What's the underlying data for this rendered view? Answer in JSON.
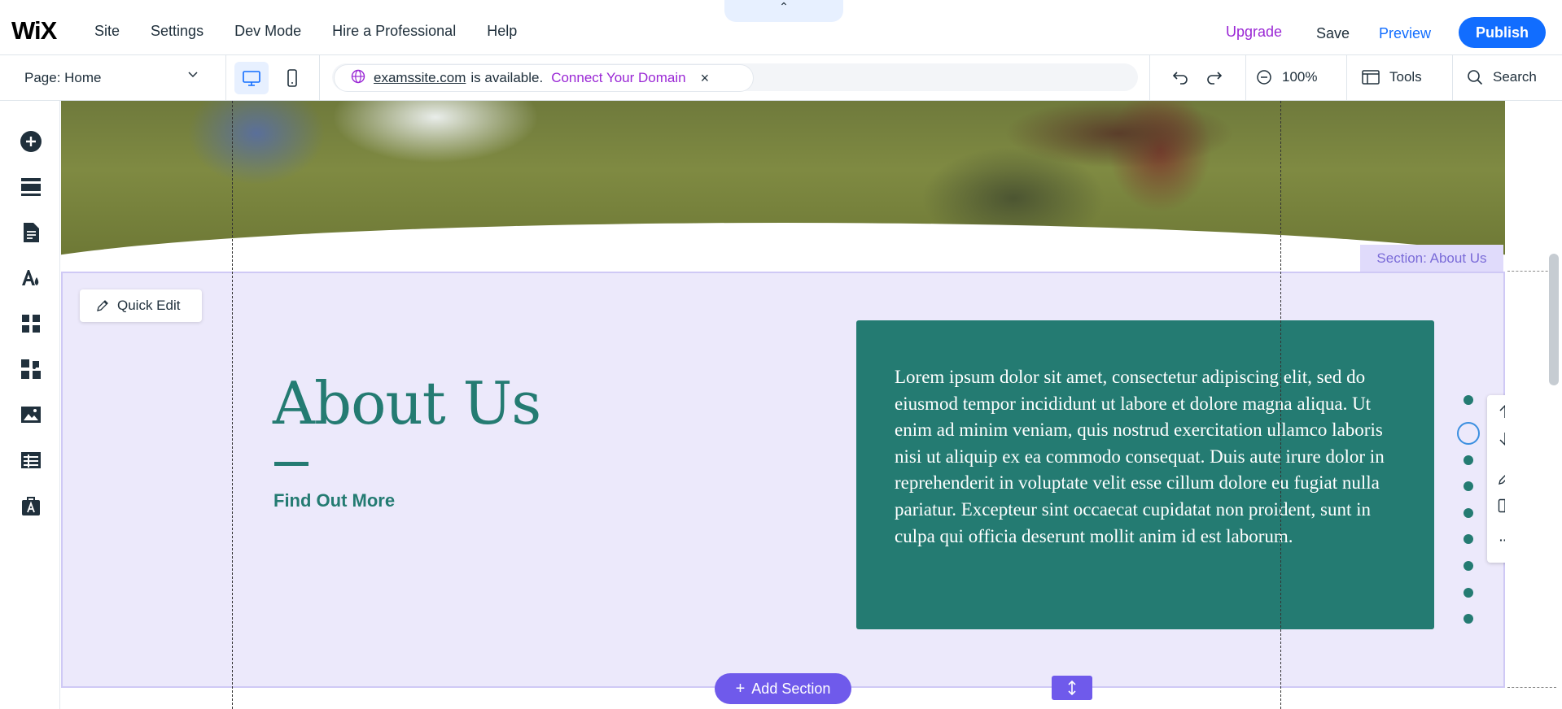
{
  "app": {
    "logo": "WiX"
  },
  "topnav": {
    "items": [
      "Site",
      "Settings",
      "Dev Mode",
      "Hire a Professional",
      "Help"
    ]
  },
  "topbar": {
    "collapse": "⌃",
    "upgrade": "Upgrade",
    "save": "Save",
    "preview": "Preview",
    "publish": "Publish"
  },
  "secondbar": {
    "page": "Page: Home",
    "domain": "examssite.com",
    "available": "is available.",
    "connect": "Connect Your Domain",
    "close": "×",
    "zoom": "100%",
    "tools": "Tools",
    "search": "Search"
  },
  "section": {
    "label": "Section: About Us",
    "quick_edit": "Quick Edit",
    "title": "About Us",
    "link": "Find Out More",
    "body": "Lorem ipsum dolor sit amet, consectetur adipiscing elit, sed do eiusmod tempor incididunt ut labore et dolore magna aliqua. Ut enim ad minim veniam, quis nostrud exercitation ullamco laboris nisi ut aliquip ex ea commodo consequat. Duis aute irure dolor in reprehenderit in voluptate velit esse cillum dolore eu fugiat nulla pariatur. Excepteur sint occaecat cupidatat non proident, sunt in culpa qui officia deserunt mollit anim id est laborum.",
    "add_section": "Add Section",
    "float_more": "···"
  },
  "colors": {
    "accent": "#116dff",
    "teal": "#247b72",
    "section_bg": "#ece9fb",
    "add_section": "#6f5aeb",
    "upgrade": "#9a27d5"
  }
}
